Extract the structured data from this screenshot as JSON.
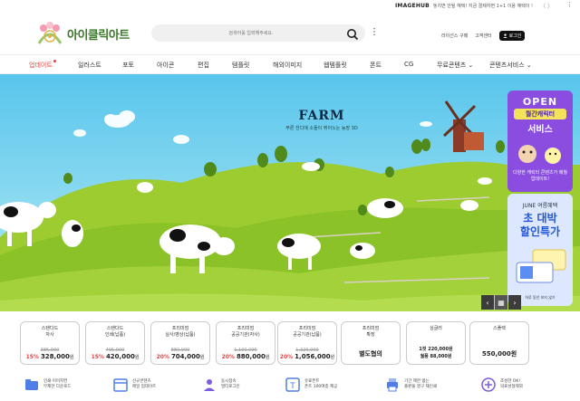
{
  "topbar": {
    "brand": "IMAGEHUB",
    "promo": "놓치면 안될 혜택! 지금 결제하면 1+1 이용 혜택이 !",
    "nav_arrows": "〈 〉",
    "more": "⋮"
  },
  "header": {
    "logo_text": "아이클릭아트",
    "search_placeholder": "검색어를 입력해주세요.",
    "license": "라이선스 구매",
    "support": "고객센터",
    "login": "로그인"
  },
  "nav": [
    {
      "label": "업데이트",
      "active": true
    },
    {
      "label": "일러스트"
    },
    {
      "label": "포토"
    },
    {
      "label": "아이콘"
    },
    {
      "label": "편집"
    },
    {
      "label": "템플릿"
    },
    {
      "label": "해외이미지"
    },
    {
      "label": "웹템플릿"
    },
    {
      "label": "폰트"
    },
    {
      "label": "CG"
    },
    {
      "label": "무료콘텐츠 ⌄"
    },
    {
      "label": "콘텐츠서비스 ⌄"
    }
  ],
  "hero": {
    "title": "FARM",
    "subtitle": "푸른 잔디에 소들이 뛰어노는 농장 3D"
  },
  "side_banner_1": {
    "open": "OPEN",
    "character": "월간캐릭터",
    "service": "서비스",
    "update": "다양한 캐릭터 콘텐츠가 매월 업데이트!"
  },
  "side_banner_2": {
    "june": "JUNE 여름혜택",
    "big1": "초 대박",
    "big2": "할인특가",
    "footer": "하루 동안 보지 않기"
  },
  "cards": [
    {
      "line1": "스탠다드",
      "line2": "자사",
      "old": "385,000",
      "pct": "15%",
      "price": "328,000",
      "won": "원"
    },
    {
      "line1": "스탠다드",
      "line2": "인쇄(납품)",
      "old": "495,000",
      "pct": "15%",
      "price": "420,000",
      "won": "원"
    },
    {
      "line1": "프리미엄",
      "line2": "실사/영상(납품)",
      "old": "880,000",
      "pct": "20%",
      "price": "704,000",
      "won": "원"
    },
    {
      "line1": "프리미엄",
      "line2": "공공기관(자사)",
      "old": "1,100,000",
      "pct": "20%",
      "price": "880,000",
      "won": "원"
    },
    {
      "line1": "프리미엄",
      "line2": "공공기관(납품)",
      "old": "1,320,000",
      "pct": "20%",
      "price": "1,056,000",
      "won": "원"
    },
    {
      "line1": "프리미엄",
      "line2": "확장",
      "single": "별도협의"
    },
    {
      "line1": "심글러",
      "line2": "",
      "multi1": "1컷 220,000원",
      "multi2": "월풍 88,000원"
    },
    {
      "line1": "스플렉",
      "line2": "",
      "single": "550,000원"
    }
  ],
  "features": [
    {
      "t1": "인쇄·이미지컨",
      "t2": "무제한 다운로드"
    },
    {
      "t1": "신규콘텐츠",
      "t2": "매일 업데이트"
    },
    {
      "t1": "동시접속",
      "t2": "멀티로그인"
    },
    {
      "t1": "유료폰트",
      "t2": "폰트 100여종 제공"
    },
    {
      "t1": "기간 제한 없는",
      "t2": "출판물 영구 재인쇄"
    },
    {
      "t1": "조성한 OK!",
      "t2": "의료성형제외"
    }
  ]
}
